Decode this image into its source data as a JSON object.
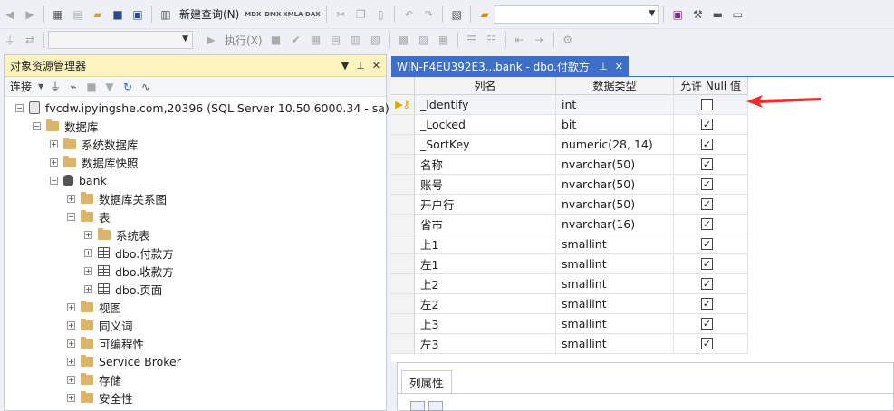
{
  "toolbar1": {
    "new_query": "新建查询(N)",
    "tech_labels": [
      "MDX",
      "DMX",
      "XMLA",
      "DAX"
    ]
  },
  "toolbar2": {
    "execute": "执行(X)"
  },
  "object_explorer": {
    "title": "对象资源管理器",
    "connect": "连接",
    "tree": [
      {
        "label": "fvcdw.ipyingshe.com,20396 (SQL Server 10.50.6000.34 - sa)",
        "icon": "server-icon",
        "exp": "⊟",
        "level": 0
      },
      {
        "label": "数据库",
        "icon": "folder-icon",
        "exp": "⊟",
        "level": 1
      },
      {
        "label": "系统数据库",
        "icon": "folder-icon",
        "exp": "⊞",
        "level": 2
      },
      {
        "label": "数据库快照",
        "icon": "folder-icon",
        "exp": "⊞",
        "level": 2
      },
      {
        "label": "bank",
        "icon": "database-icon",
        "exp": "⊟",
        "level": 2
      },
      {
        "label": "数据库关系图",
        "icon": "folder-icon",
        "exp": "⊞",
        "level": 3
      },
      {
        "label": "表",
        "icon": "folder-icon",
        "exp": "⊟",
        "level": 3
      },
      {
        "label": "系统表",
        "icon": "folder-icon",
        "exp": "⊞",
        "level": 4
      },
      {
        "label": "dbo.付款方",
        "icon": "table-icon",
        "exp": "⊞",
        "level": 4
      },
      {
        "label": "dbo.收款方",
        "icon": "table-icon",
        "exp": "⊞",
        "level": 4
      },
      {
        "label": "dbo.页面",
        "icon": "table-icon",
        "exp": "⊞",
        "level": 4
      },
      {
        "label": "视图",
        "icon": "folder-icon",
        "exp": "⊞",
        "level": 3
      },
      {
        "label": "同义词",
        "icon": "folder-icon",
        "exp": "⊞",
        "level": 3
      },
      {
        "label": "可编程性",
        "icon": "folder-icon",
        "exp": "⊞",
        "level": 3
      },
      {
        "label": "Service Broker",
        "icon": "folder-icon",
        "exp": "⊞",
        "level": 3
      },
      {
        "label": "存储",
        "icon": "folder-icon",
        "exp": "⊞",
        "level": 3
      },
      {
        "label": "安全性",
        "icon": "folder-icon",
        "exp": "⊞",
        "level": 3
      }
    ]
  },
  "document_tab": {
    "title": "WIN-F4EU392E3...bank - dbo.付款方"
  },
  "designer": {
    "headers": [
      "列名",
      "数据类型",
      "允许 Null 值"
    ],
    "rows": [
      {
        "name": "_Identify",
        "type": "int",
        "nullable": false,
        "key": true
      },
      {
        "name": "_Locked",
        "type": "bit",
        "nullable": true
      },
      {
        "name": "_SortKey",
        "type": "numeric(28, 14)",
        "nullable": true
      },
      {
        "name": "名称",
        "type": "nvarchar(50)",
        "nullable": true
      },
      {
        "name": "账号",
        "type": "nvarchar(50)",
        "nullable": true
      },
      {
        "name": "开户行",
        "type": "nvarchar(50)",
        "nullable": true
      },
      {
        "name": "省市",
        "type": "nvarchar(16)",
        "nullable": true
      },
      {
        "name": "上1",
        "type": "smallint",
        "nullable": true
      },
      {
        "name": "左1",
        "type": "smallint",
        "nullable": true
      },
      {
        "name": "上2",
        "type": "smallint",
        "nullable": true
      },
      {
        "name": "左2",
        "type": "smallint",
        "nullable": true
      },
      {
        "name": "上3",
        "type": "smallint",
        "nullable": true
      },
      {
        "name": "左3",
        "type": "smallint",
        "nullable": true
      }
    ]
  },
  "properties": {
    "tab": "列属性"
  },
  "colors": {
    "tab_active": "#3e6fc6",
    "explorer_title": "#fdf4bf",
    "annotation_arrow": "#e8312a"
  }
}
